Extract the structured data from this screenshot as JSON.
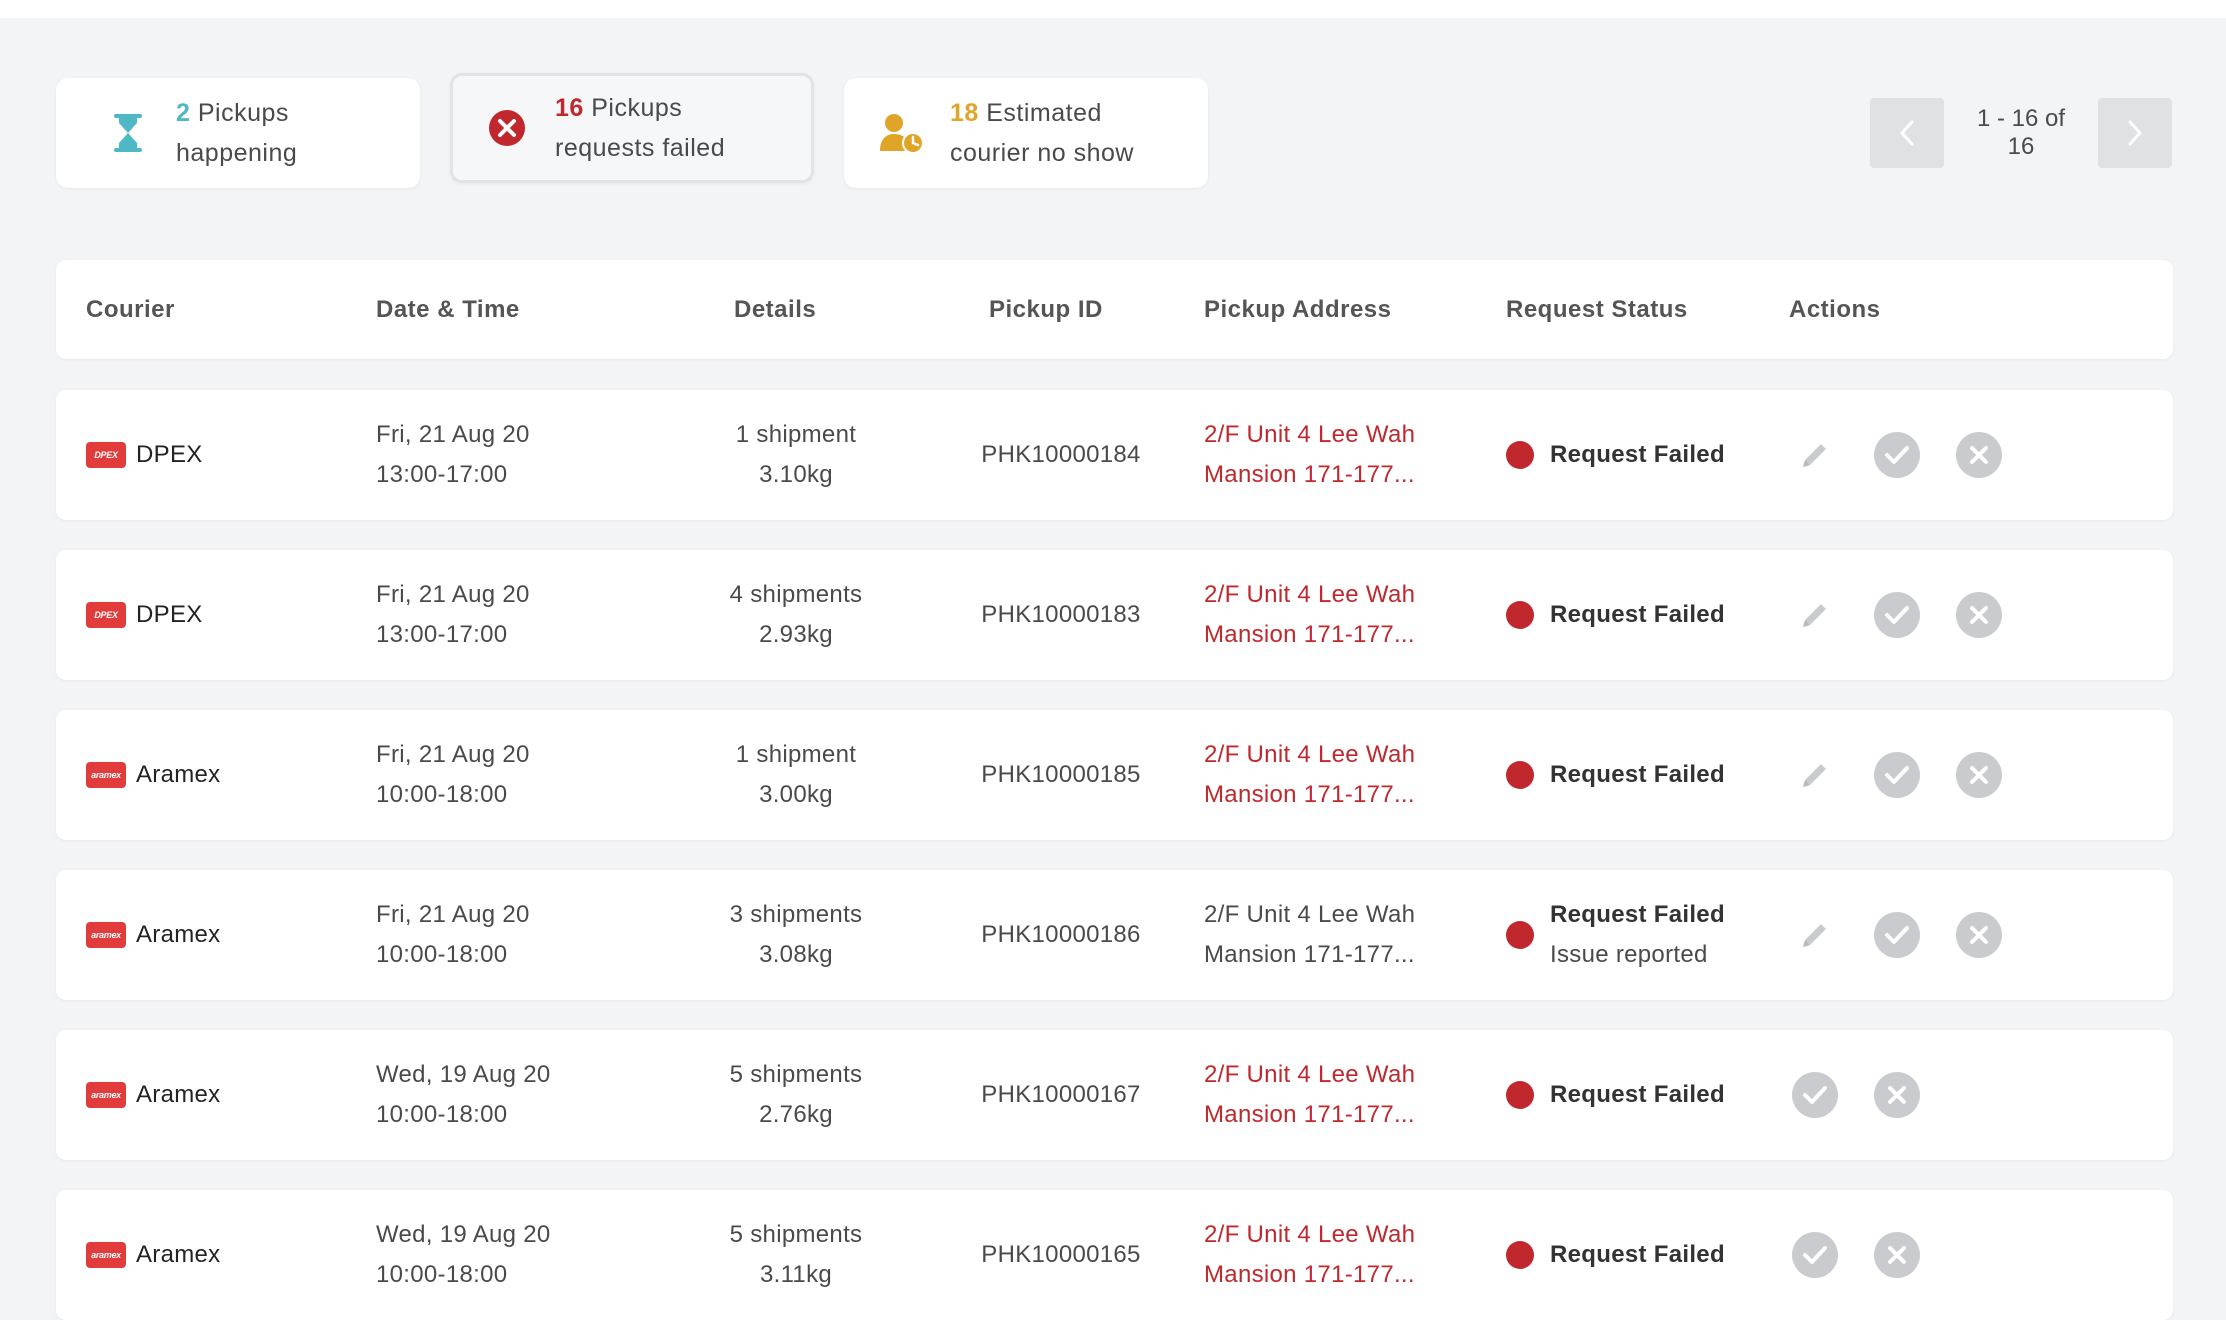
{
  "summary": {
    "happening": {
      "count": "2",
      "line1": " Pickups",
      "line2": "happening",
      "color": "#4fb8c7",
      "icon": "hourglass-icon"
    },
    "failed": {
      "count": "16",
      "line1": " Pickups",
      "line2": "requests failed",
      "color": "#c0282d",
      "icon": "error-circle-icon"
    },
    "noshow": {
      "count": "18",
      "line1": " Estimated",
      "line2": "courier no show",
      "color": "#e0a527",
      "icon": "courier-clock-icon"
    }
  },
  "pagination": {
    "label": "1 - 16 of 16"
  },
  "table": {
    "headers": {
      "courier": "Courier",
      "datetime": "Date & Time",
      "details": "Details",
      "pickup_id": "Pickup ID",
      "address": "Pickup Address",
      "status": "Request Status",
      "actions": "Actions"
    },
    "rows": [
      {
        "courier": "DPEX",
        "logo": "DPEX",
        "date": "Fri, 21 Aug 20",
        "time": "13:00-17:00",
        "shipments": "1 shipment",
        "weight": "3.10kg",
        "pickup_id": "PHK10000184",
        "addr1": "2/F Unit 4 Lee Wah",
        "addr2": "Mansion 171-177...",
        "status": "Request Failed",
        "status_sub": ""
      },
      {
        "courier": "DPEX",
        "logo": "DPEX",
        "date": "Fri, 21 Aug 20",
        "time": "13:00-17:00",
        "shipments": "4 shipments",
        "weight": "2.93kg",
        "pickup_id": "PHK10000183",
        "addr1": "2/F Unit 4 Lee Wah",
        "addr2": "Mansion 171-177...",
        "status": "Request Failed",
        "status_sub": ""
      },
      {
        "courier": "Aramex",
        "logo": "aramex",
        "date": "Fri, 21 Aug 20",
        "time": "10:00-18:00",
        "shipments": "1 shipment",
        "weight": "3.00kg",
        "pickup_id": "PHK10000185",
        "addr1": "2/F Unit 4 Lee Wah",
        "addr2": "Mansion 171-177...",
        "status": "Request Failed",
        "status_sub": ""
      },
      {
        "courier": "Aramex",
        "logo": "aramex",
        "date": "Fri, 21 Aug 20",
        "time": "10:00-18:00",
        "shipments": "3 shipments",
        "weight": "3.08kg",
        "pickup_id": "PHK10000186",
        "addr1": "2/F Unit 4 Lee Wah",
        "addr2": "Mansion 171-177...",
        "status": "Request Failed",
        "status_sub": "Issue reported"
      },
      {
        "courier": "Aramex",
        "logo": "aramex",
        "date": "Wed, 19 Aug 20",
        "time": "10:00-18:00",
        "shipments": "5 shipments",
        "weight": "2.76kg",
        "pickup_id": "PHK10000167",
        "addr1": "2/F Unit 4 Lee Wah",
        "addr2": "Mansion 171-177...",
        "status": "Request Failed",
        "status_sub": ""
      },
      {
        "courier": "Aramex",
        "logo": "aramex",
        "date": "Wed, 19 Aug 20",
        "time": "10:00-18:00",
        "shipments": "5 shipments",
        "weight": "3.11kg",
        "pickup_id": "PHK10000165",
        "addr1": "2/F Unit 4 Lee Wah",
        "addr2": "Mansion 171-177...",
        "status": "Request Failed",
        "status_sub": ""
      }
    ]
  }
}
